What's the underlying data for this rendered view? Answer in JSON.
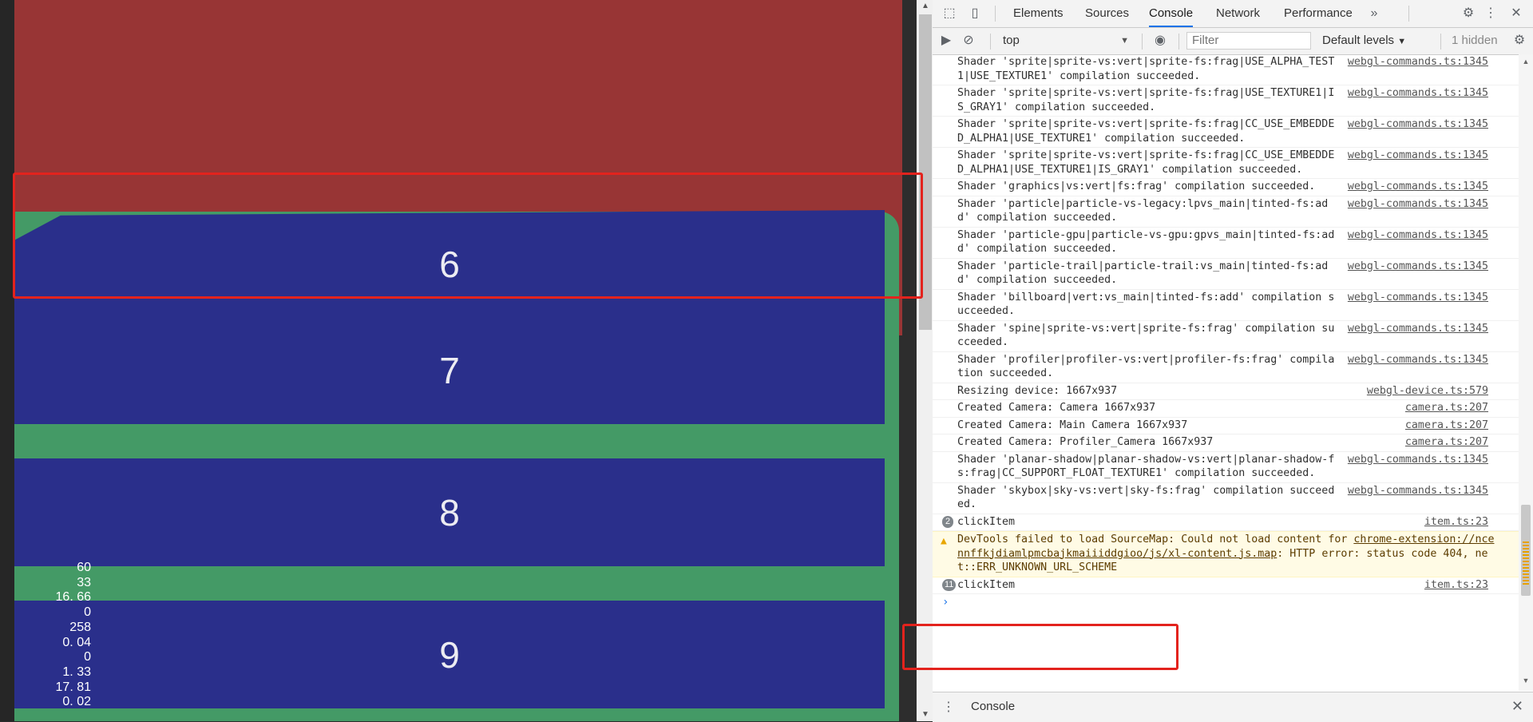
{
  "game": {
    "items": [
      "6",
      "7",
      "8",
      "9"
    ],
    "stats": [
      "60",
      "33",
      "16. 66",
      "0",
      "258",
      "0. 04",
      "0",
      "1. 33",
      "17. 81",
      "0. 02"
    ],
    "colors": {
      "background": "#983535",
      "item": "#2a2f8b",
      "spacer": "#449a66",
      "highlight": "#e3231d"
    }
  },
  "devtools": {
    "tabs": [
      "Elements",
      "Sources",
      "Console",
      "Network",
      "Performance"
    ],
    "active_tab": "Console",
    "toolbar": {
      "context": "top",
      "filter_placeholder": "Filter",
      "levels": "Default levels",
      "hidden": "1 hidden"
    },
    "messages": [
      {
        "text": "Shader 'sprite|sprite-vs:vert|sprite-fs:frag|USE_ALPHA_TEST1|USE_TEXTURE1' compilation succeeded.",
        "source": "webgl-commands.ts:1345"
      },
      {
        "text": "Shader 'sprite|sprite-vs:vert|sprite-fs:frag|USE_TEXTURE1|IS_GRAY1' compilation succeeded.",
        "source": "webgl-commands.ts:1345"
      },
      {
        "text": "Shader 'sprite|sprite-vs:vert|sprite-fs:frag|CC_USE_EMBEDDED_ALPHA1|USE_TEXTURE1' compilation succeeded.",
        "source": "webgl-commands.ts:1345"
      },
      {
        "text": "Shader 'sprite|sprite-vs:vert|sprite-fs:frag|CC_USE_EMBEDDED_ALPHA1|USE_TEXTURE1|IS_GRAY1' compilation succeeded.",
        "source": "webgl-commands.ts:1345"
      },
      {
        "text": "Shader 'graphics|vs:vert|fs:frag' compilation succeeded.",
        "source": "webgl-commands.ts:1345"
      },
      {
        "text": "Shader 'particle|particle-vs-legacy:lpvs_main|tinted-fs:add' compilation succeeded.",
        "source": "webgl-commands.ts:1345"
      },
      {
        "text": "Shader 'particle-gpu|particle-vs-gpu:gpvs_main|tinted-fs:add' compilation succeeded.",
        "source": "webgl-commands.ts:1345"
      },
      {
        "text": "Shader 'particle-trail|particle-trail:vs_main|tinted-fs:add' compilation succeeded.",
        "source": "webgl-commands.ts:1345"
      },
      {
        "text": "Shader 'billboard|vert:vs_main|tinted-fs:add' compilation succeeded.",
        "source": "webgl-commands.ts:1345"
      },
      {
        "text": "Shader 'spine|sprite-vs:vert|sprite-fs:frag' compilation succeeded.",
        "source": "webgl-commands.ts:1345"
      },
      {
        "text": "Shader 'profiler|profiler-vs:vert|profiler-fs:frag' compilation succeeded.",
        "source": "webgl-commands.ts:1345"
      },
      {
        "text": "Resizing device: 1667x937",
        "source": "webgl-device.ts:579"
      },
      {
        "text": "Created Camera: Camera 1667x937",
        "source": "camera.ts:207"
      },
      {
        "text": "Created Camera: Main Camera 1667x937",
        "source": "camera.ts:207"
      },
      {
        "text": "Created Camera: Profiler_Camera 1667x937",
        "source": "camera.ts:207"
      },
      {
        "text": "Shader 'planar-shadow|planar-shadow-vs:vert|planar-shadow-fs:frag|CC_SUPPORT_FLOAT_TEXTURE1' compilation succeeded.",
        "source": "webgl-commands.ts:1345"
      },
      {
        "text": "Shader 'skybox|sky-vs:vert|sky-fs:frag' compilation succeeded.",
        "source": "webgl-commands.ts:1345"
      }
    ],
    "click_item_1": {
      "count": "2",
      "text": "clickItem",
      "source": "item.ts:23"
    },
    "warning": {
      "pre": "DevTools failed to load SourceMap: Could not load content for ",
      "link": "chrome-extension://ncennffkjdiamlpmcbajkmaiiiddgioo/js/xl-content.js.map",
      "post": ": HTTP error: status code 404, net::ERR_UNKNOWN_URL_SCHEME"
    },
    "click_item_2": {
      "count": "11",
      "text": "clickItem",
      "source": "item.ts:23"
    },
    "prompt": "›",
    "drawer_label": "Console"
  }
}
